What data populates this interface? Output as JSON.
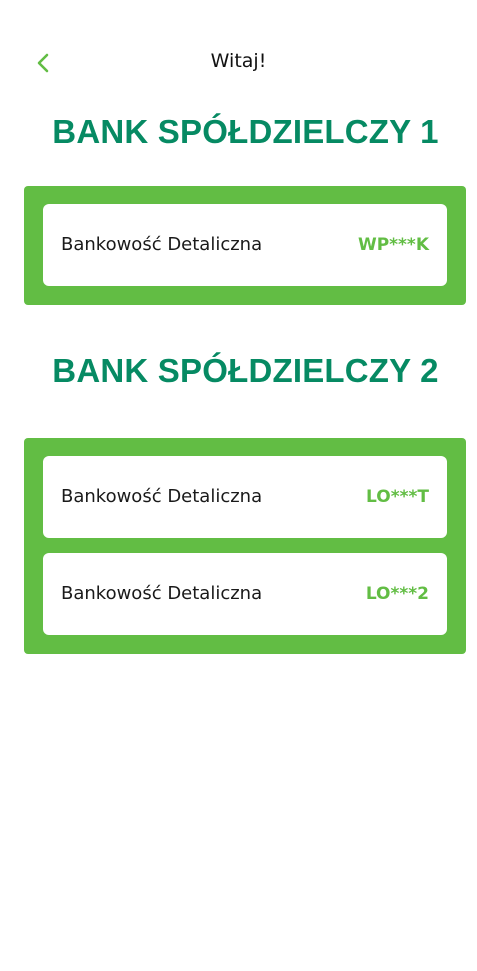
{
  "header": {
    "title": "Witaj!",
    "back_icon": "chevron-left-icon"
  },
  "colors": {
    "brand_green": "#62bd44",
    "title_green": "#068a63"
  },
  "banks": [
    {
      "name": "BANK SPÓŁDZIELCZY 1",
      "accounts": [
        {
          "type": "Bankowość Detaliczna",
          "login": "WP***K"
        }
      ]
    },
    {
      "name": "BANK SPÓŁDZIELCZY 2",
      "accounts": [
        {
          "type": "Bankowość Detaliczna",
          "login": "LO***T"
        },
        {
          "type": "Bankowość Detaliczna",
          "login": "LO***2"
        }
      ]
    }
  ]
}
